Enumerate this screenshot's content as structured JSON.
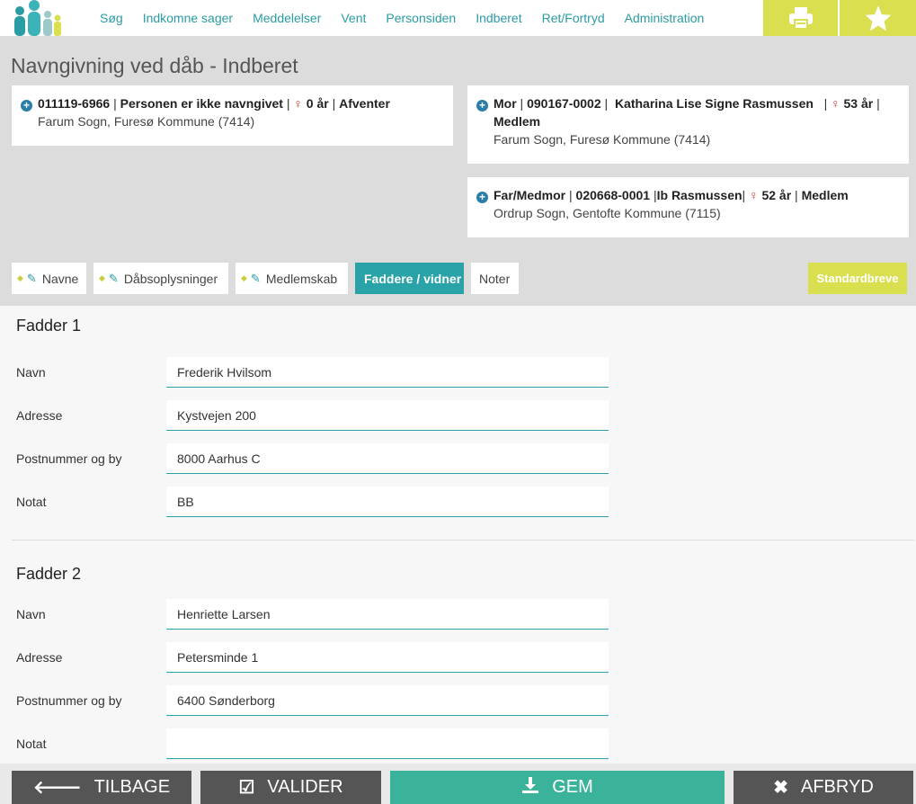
{
  "nav": {
    "items": [
      "Søg",
      "Indkomne sager",
      "Meddelelser",
      "Vent",
      "Personsiden",
      "Indberet",
      "Ret/Fortryd",
      "Administration"
    ],
    "print_icon": "printer-icon",
    "favorite_icon": "star-icon"
  },
  "page": {
    "title": "Navngivning ved dåb - Indberet"
  },
  "child": {
    "cpr": "011119-6966",
    "status": "Personen er ikke navngivet",
    "age": "0 år",
    "state": "Afventer",
    "parish": "Farum Sogn, Furesø Kommune (7414)"
  },
  "mother": {
    "role": "Mor",
    "cpr": "090167-0002",
    "name": "Katharina Lise Signe Rasmussen",
    "age": "53 år",
    "membership": "Medlem",
    "parish": "Farum Sogn, Furesø Kommune (7414)"
  },
  "father": {
    "role": "Far/Medmor",
    "cpr": "020668-0001",
    "name": "Ib Rasmussen",
    "age": "52 år",
    "membership": "Medlem",
    "parish": "Ordrup Sogn, Gentofte Kommune (7115)"
  },
  "tabs": {
    "navne": "Navne",
    "daab": "Dåbsoplysninger",
    "medlemskab": "Medlemskab",
    "faddere": "Faddere / vidner",
    "noter": "Noter",
    "standardbreve": "Standardbreve"
  },
  "labels": {
    "navn": "Navn",
    "adresse": "Adresse",
    "postnr": "Postnummer og by",
    "notat": "Notat"
  },
  "fadder1": {
    "title": "Fadder 1",
    "navn": "Frederik Hvilsom",
    "adresse": "Kystvejen 200",
    "postnr": "8000 Aarhus C",
    "notat": "BB"
  },
  "fadder2": {
    "title": "Fadder 2",
    "navn": "Henriette Larsen",
    "adresse": "Petersminde 1",
    "postnr": "6400 Sønderborg",
    "notat": ""
  },
  "buttons": {
    "tilbage": "TILBAGE",
    "valider": "VALIDER",
    "gem": "GEM",
    "afbryd": "AFBRYD"
  },
  "colors": {
    "accent": "#2aa3a8",
    "highlight": "#d9df4f",
    "save": "#3bb39a",
    "dark_button": "#555555"
  }
}
